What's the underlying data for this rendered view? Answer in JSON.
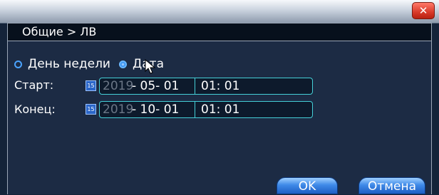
{
  "window": {
    "close_glyph": "✕"
  },
  "header": {
    "title": "Общие > ЛВ"
  },
  "mode": {
    "options": [
      {
        "label": "День недели",
        "selected": false
      },
      {
        "label": "Дата",
        "selected": true
      }
    ]
  },
  "start": {
    "label": "Старт:",
    "year": "2019",
    "month_day": "- 05- 01",
    "time": "01: 01",
    "icon": "calendar-icon"
  },
  "end": {
    "label": "Конец:",
    "year": "2019",
    "month_day": "- 10- 01",
    "time": "01: 01",
    "icon": "calendar-icon"
  },
  "buttons": {
    "ok": "OK",
    "cancel": "Отмена"
  },
  "colors": {
    "accent": "#45d0d8",
    "background": "#1c2b44",
    "button": "#3f8ae8",
    "close": "#d83a2a"
  }
}
